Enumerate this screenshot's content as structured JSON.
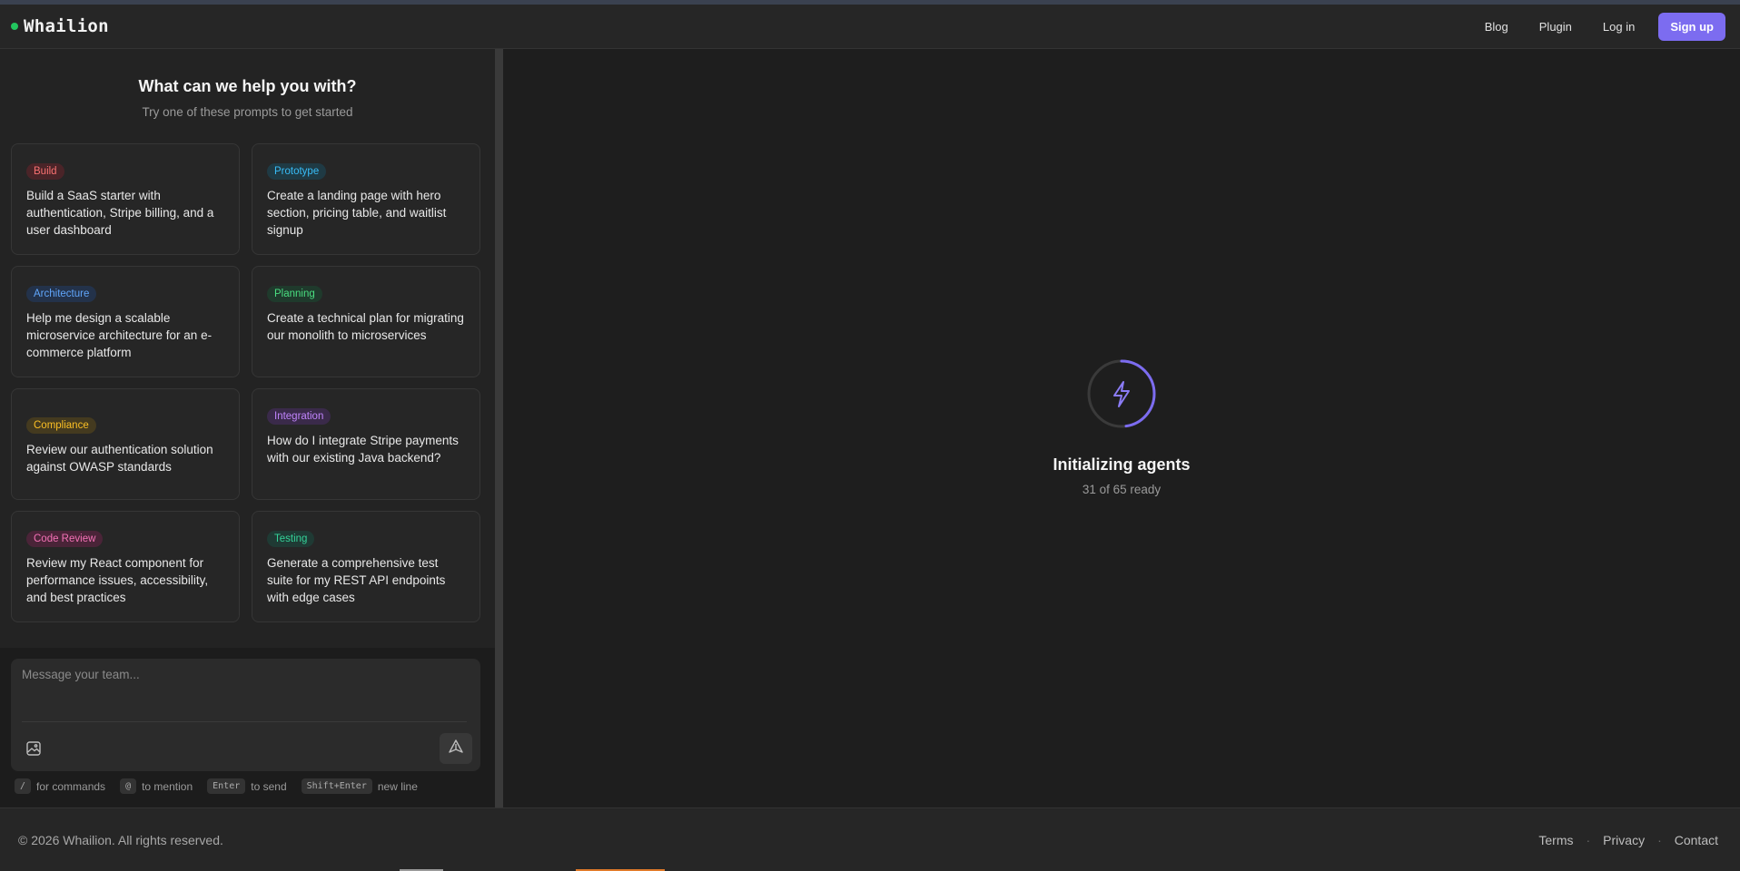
{
  "header": {
    "brand": "Whailion",
    "nav": [
      {
        "label": "Blog"
      },
      {
        "label": "Plugin"
      },
      {
        "label": "Log in"
      }
    ],
    "signup_label": "Sign up"
  },
  "left_panel": {
    "title": "What can we help you with?",
    "subtitle": "Try one of these prompts to get started",
    "cards": [
      {
        "tag": "Build",
        "text": "Build a SaaS starter with authentication, Stripe billing, and a user dashboard",
        "tag_bg": "#4a2428",
        "tag_fg": "#f87171"
      },
      {
        "tag": "Prototype",
        "text": "Create a landing page with hero section, pricing table, and waitlist signup",
        "tag_bg": "#1f3a44",
        "tag_fg": "#38bdf8"
      },
      {
        "tag": "Architecture",
        "text": "Help me design a scalable microservice architecture for an e-commerce platform",
        "tag_bg": "#23324a",
        "tag_fg": "#60a5fa"
      },
      {
        "tag": "Planning",
        "text": "Create a technical plan for migrating our monolith to microservices",
        "tag_bg": "#1f3a2c",
        "tag_fg": "#4ade80"
      },
      {
        "tag": "Compliance",
        "text": "Review our authentication solution against OWASP standards",
        "tag_bg": "#443a1f",
        "tag_fg": "#fbbf24"
      },
      {
        "tag": "Integration",
        "text": "How do I integrate Stripe payments with our existing Java backend?",
        "tag_bg": "#3a2a4a",
        "tag_fg": "#c084fc"
      },
      {
        "tag": "Code Review",
        "text": "Review my React component for performance issues, accessibility, and best practices",
        "tag_bg": "#4a2438",
        "tag_fg": "#f472b6"
      },
      {
        "tag": "Testing",
        "text": "Generate a comprehensive test suite for my REST API endpoints with edge cases",
        "tag_bg": "#1f3a34",
        "tag_fg": "#34d399"
      }
    ]
  },
  "composer": {
    "placeholder": "Message your team...",
    "hints": [
      {
        "key": "/",
        "text": "for commands"
      },
      {
        "key": "@",
        "text": "to mention"
      },
      {
        "key": "Enter",
        "text": "to send"
      },
      {
        "key": "Shift+Enter",
        "text": "new line"
      }
    ]
  },
  "main": {
    "status_title": "Initializing agents",
    "status_subtitle": "31 of 65 ready",
    "progress": 0.477,
    "accent": "#7c6cf0"
  },
  "footer": {
    "copyright": "© 2026 Whailion. All rights reserved.",
    "links": [
      "Terms",
      "Privacy",
      "Contact"
    ]
  }
}
